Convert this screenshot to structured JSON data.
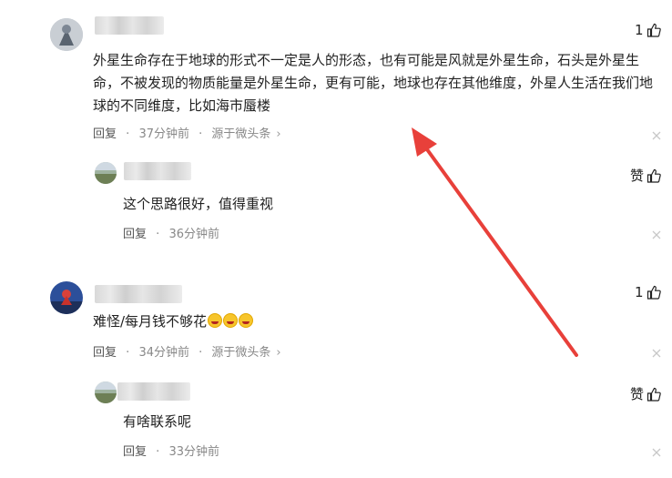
{
  "comments": [
    {
      "text": "外星生命存在于地球的形式不一定是人的形态，也有可能是风就是外星生命，石头是外星生命，不被发现的物质能量是外星生命，更有可能，地球也存在其他维度，外星人生活在我们地球的不同维度，比如海市蜃楼",
      "like_count": "1",
      "reply_label": "回复",
      "time": "37分钟前",
      "source": "源于微头条",
      "reply": {
        "text": "这个思路很好，值得重视",
        "like_label": "赞",
        "reply_label": "回复",
        "time": "36分钟前"
      }
    },
    {
      "text": "难怪/每月钱不够花",
      "like_count": "1",
      "reply_label": "回复",
      "time": "34分钟前",
      "source": "源于微头条",
      "reply": {
        "text": "有啥联系呢",
        "like_label": "赞",
        "reply_label": "回复",
        "time": "33分钟前"
      }
    }
  ],
  "separator": "·",
  "chevron": "›",
  "icons": {
    "thumb": "thumb-up-icon",
    "close": "close-icon",
    "emoji": "laughing-emoji-icon",
    "arrow": "red-arrow-annotation"
  },
  "colors": {
    "arrow": "#e8403a",
    "meta": "#888888",
    "text": "#222222"
  }
}
